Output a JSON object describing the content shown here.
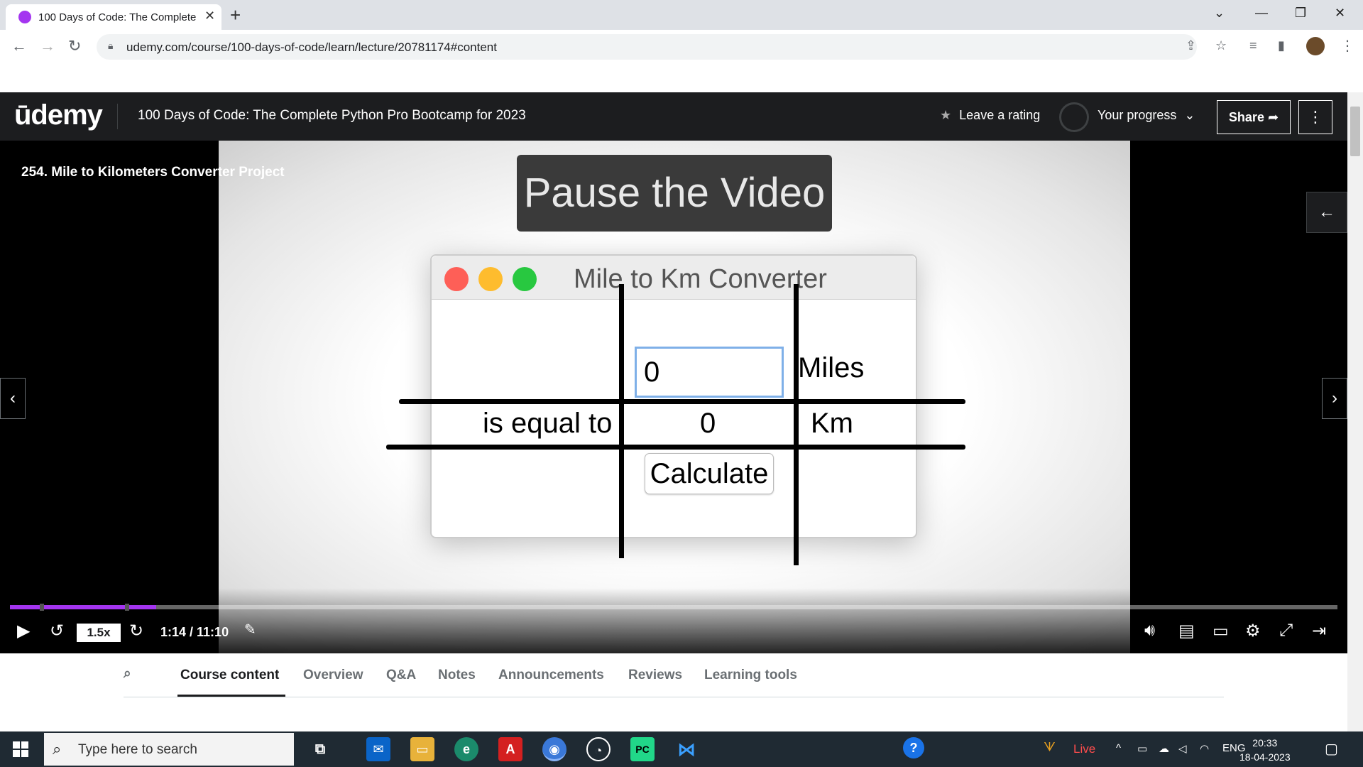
{
  "browser": {
    "tab_title": "100 Days of Code: The Complete",
    "tab_close": "✕",
    "new_tab": "+",
    "url": "udemy.com/course/100-days-of-code/learn/lecture/20781174#content"
  },
  "header": {
    "logo": "ūdemy",
    "course_title": "100 Days of Code: The Complete Python Pro Bootcamp for 2023",
    "leave_rating": "Leave a rating",
    "your_progress": "Your progress",
    "share": "Share",
    "more": "⋮"
  },
  "video": {
    "lecture_title": "254. Mile to Kilometers Converter Project",
    "overlay_text": "Pause the Video",
    "app": {
      "window_title": "Mile to Km Converter",
      "miles_value": "0",
      "miles_label": "Miles",
      "equal_label": "is equal to",
      "km_value": "0",
      "km_label": "Km",
      "calculate": "Calculate"
    },
    "controls": {
      "speed": "1.5x",
      "time": "1:14 / 11:10",
      "progress_fraction": 0.11
    }
  },
  "nav_tabs": [
    "Course content",
    "Overview",
    "Q&A",
    "Notes",
    "Announcements",
    "Reviews",
    "Learning tools"
  ],
  "taskbar": {
    "search_placeholder": "Type here to search",
    "live": "Live",
    "language": "ENG",
    "time": "20:33",
    "date": "18-04-2023"
  },
  "colors": {
    "brand": "#a435f0",
    "header_bg": "#1c1d1f",
    "taskbar_bg": "#1f2a33"
  }
}
